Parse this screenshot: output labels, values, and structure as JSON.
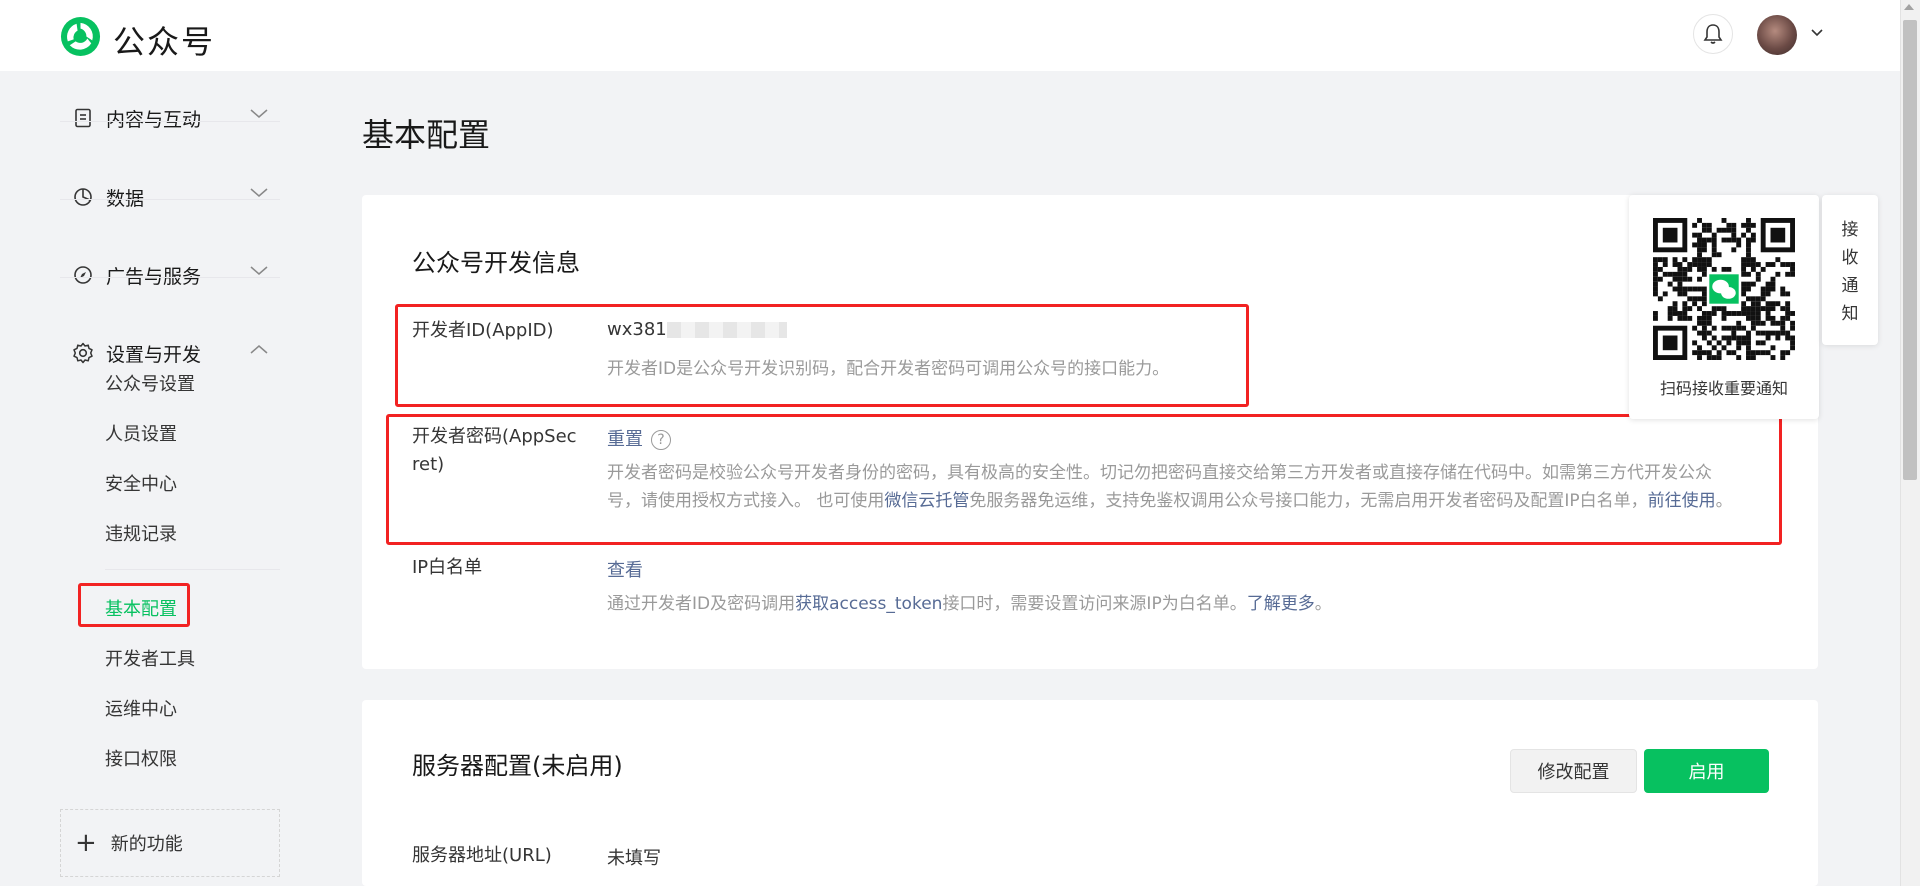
{
  "header": {
    "brand": "公众号"
  },
  "sidebar": {
    "groups": [
      {
        "label": "内容与互动",
        "icon": "document-icon",
        "expanded": false
      },
      {
        "label": "数据",
        "icon": "pie-chart-icon",
        "expanded": false
      },
      {
        "label": "广告与服务",
        "icon": "compass-icon",
        "expanded": false
      },
      {
        "label": "设置与开发",
        "icon": "gear-icon",
        "expanded": true
      }
    ],
    "settings_items": [
      "公众号设置",
      "人员设置",
      "安全中心",
      "违规记录"
    ],
    "dev_items": [
      "基本配置",
      "开发者工具",
      "运维中心",
      "接口权限"
    ],
    "active_item": "基本配置",
    "new_feature": "新的功能"
  },
  "main": {
    "page_title": "基本配置",
    "dev_info": {
      "title": "公众号开发信息",
      "appid": {
        "label": "开发者ID(AppID)",
        "value": "wx381",
        "desc": "开发者ID是公众号开发识别码，配合开发者密码可调用公众号的接口能力。"
      },
      "appsecret": {
        "label_1": "开发者密码(AppSec",
        "label_2": "ret)",
        "action": "重置",
        "help": "?",
        "desc_1": "开发者密码是校验公众号开发者身份的密码，具有极高的安全性。切记勿把密码直接交给第三方开发者或直接存储在代码中。如需第三方代开发公众",
        "desc_2a": "号，请使用授权方式接入。 也可使用",
        "desc_2b": "微信云托管",
        "desc_2c": "免服务器免运维，支持免鉴权调用公众号接口能力，无需启用开发者密码及配置IP白名单，",
        "desc_2d": "前往使用",
        "desc_2e": "。"
      },
      "ip_whitelist": {
        "label": "IP白名单",
        "action": "查看",
        "desc_a": "通过开发者ID及密码调用",
        "desc_b": "获取access_token",
        "desc_c": "接口时，需要设置访问来源IP为白名单。",
        "desc_d": "了解更多",
        "desc_e": "。"
      }
    },
    "server_config": {
      "title": "服务器配置(未启用)",
      "modify_button": "修改配置",
      "enable_button": "启用",
      "url_label": "服务器地址(URL)",
      "url_value": "未填写"
    }
  },
  "qr_panel": {
    "caption": "扫码接收重要通知",
    "tab_chars": [
      "接",
      "收",
      "通",
      "知"
    ]
  },
  "colors": {
    "accent": "#07c160",
    "link": "#576b95",
    "annotation_red": "#f22222"
  }
}
